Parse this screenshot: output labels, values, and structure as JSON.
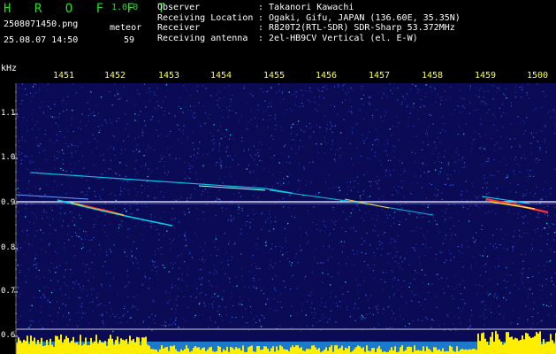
{
  "app": {
    "name": "H R O F F T",
    "version": "1.0.0"
  },
  "file": {
    "name": "2508071450.png",
    "timestamp": "25.08.07 14:50"
  },
  "meteor": {
    "label": "meteor",
    "count": "59"
  },
  "info": [
    {
      "key": "Observer",
      "value": ": Takanori Kawachi"
    },
    {
      "key": "Receiving Location",
      "value": ": Ogaki, Gifu, JAPAN (136.60E, 35.35N)"
    },
    {
      "key": "Receiver",
      "value": ": R820T2(RTL-SDR) SDR-Sharp 53.372MHz"
    },
    {
      "key": "Receiving antenna",
      "value": ": 2el-HB9CV Vertical (el. E-W)"
    }
  ],
  "axis": {
    "y_unit": "kHz",
    "y_ticks": [
      "1.1",
      "1.0",
      "0.9",
      "0.8",
      "0.7",
      "0.6"
    ],
    "x_ticks": [
      "1451",
      "1452",
      "1453",
      "1454",
      "1455",
      "1456",
      "1457",
      "1458",
      "1459",
      "1500"
    ]
  },
  "colors": {
    "background": "#0a0a55",
    "carrier": "#e8e8ff",
    "trace": "#00e5ff",
    "strong": "#ff3333",
    "histogram": "#ffee00",
    "logo": "#22dd22"
  }
}
